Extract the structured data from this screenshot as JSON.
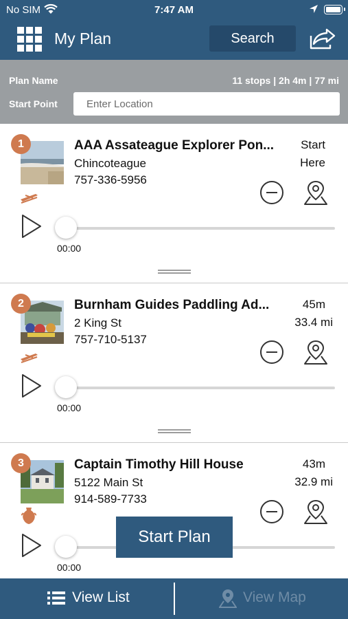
{
  "status_bar": {
    "carrier": "No SIM",
    "time": "7:47 AM"
  },
  "header": {
    "title": "My Plan",
    "search_label": "Search"
  },
  "plan": {
    "name_label": "Plan Name",
    "start_label": "Start Point",
    "stats": "11 stops | 2h 4m | 77 mi",
    "location_placeholder": "Enter Location",
    "location_value": ""
  },
  "stops": [
    {
      "number": "1",
      "name": "AAA Assateague Explorer Pon...",
      "address": "Chincoteague",
      "phone": "757-336-5956",
      "meta_top": "Start",
      "meta_bottom": "Here",
      "time": "00:00",
      "audio_progress": 0,
      "category_icon": "kayak-icon"
    },
    {
      "number": "2",
      "name": "Burnham Guides Paddling Ad...",
      "address": "2 King St",
      "phone": "757-710-5137",
      "meta_top": "45m",
      "meta_bottom": "33.4 mi",
      "time": "00:00",
      "audio_progress": 0,
      "category_icon": "kayak-icon"
    },
    {
      "number": "3",
      "name": "Captain Timothy Hill House",
      "address": "5122 Main St",
      "phone": "914-589-7733",
      "meta_top": "43m",
      "meta_bottom": "32.9 mi",
      "time": "00:00",
      "audio_progress": 0,
      "category_icon": "vase-icon"
    }
  ],
  "start_plan_label": "Start Plan",
  "tabbar": {
    "list_label": "View List",
    "map_label": "View Map"
  },
  "colors": {
    "primary": "#2f5a7e",
    "primary_dark": "#25496a",
    "panel_gray": "#9a9ea1",
    "accent_orange": "#cf7a4f",
    "disabled_tab": "#6f8ca6"
  }
}
